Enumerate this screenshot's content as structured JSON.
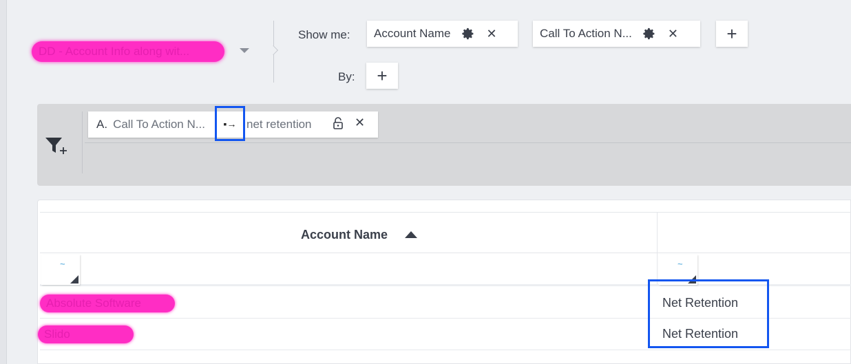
{
  "header": {
    "report_name": "DD - Account Info along wit...",
    "show_me_label": "Show me:",
    "by_label": "By:",
    "pills": [
      {
        "label": "Account Name"
      },
      {
        "label": "Call To Action N..."
      }
    ],
    "add_label": "+",
    "by_add_label": "+"
  },
  "filter": {
    "letter": "A.",
    "field": "Call To Action N...",
    "operator": "▪→",
    "value": "net retention",
    "close": "✕"
  },
  "table": {
    "header_account": "Account Name",
    "tilde": "~",
    "rows": [
      {
        "account": "Absolute Software",
        "cta": "Net Retention"
      },
      {
        "account": "Slido",
        "cta": "Net Retention"
      }
    ]
  },
  "icons": {
    "close": "✕"
  },
  "colors": {
    "highlight": "#1356f0",
    "redaction": "#ff2dc4"
  }
}
